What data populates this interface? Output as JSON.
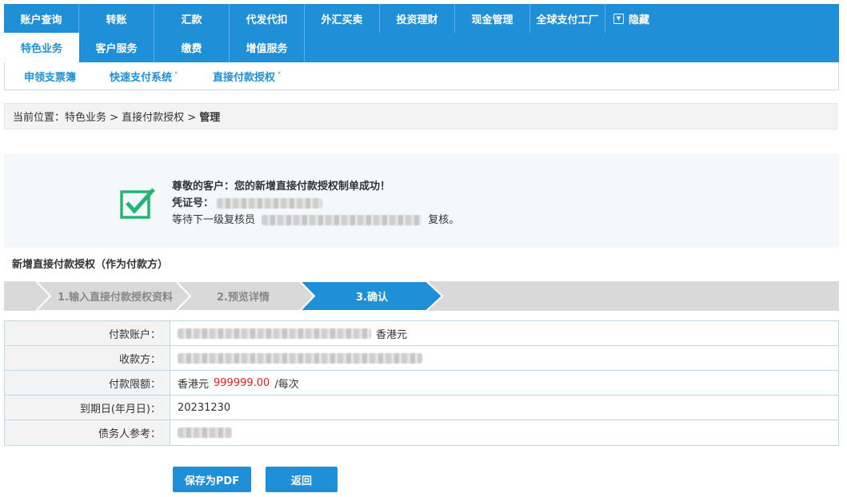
{
  "nav": {
    "row1": [
      "账户查询",
      "转账",
      "汇款",
      "代发代扣",
      "外汇买卖",
      "投资理财",
      "现金管理",
      "全球支付工厂"
    ],
    "hide_label": "隐藏",
    "row2": [
      "特色业务",
      "客户服务",
      "缴费",
      "增值服务"
    ]
  },
  "subnav": [
    "申领支票簿",
    "快速支付系统",
    "直接付款授权"
  ],
  "breadcrumb": {
    "prefix": "当前位置：特色业务 > 直接付款授权 >",
    "current": "管理"
  },
  "success": {
    "title": "尊敬的客户：您的新增直接付款授权制单成功！",
    "voucher_label": "凭证号：",
    "wait_prefix": "等待下一级复核员",
    "wait_suffix": "复核。"
  },
  "section_title": "新增直接付款授权（作为付款方）",
  "steps": [
    "1.输入直接付款授权资料",
    "2.预览详情",
    "3.确认"
  ],
  "form": {
    "payer_label": "付款账户：",
    "payer_currency": "香港元",
    "payee_label": "收款方：",
    "limit_label": "付款限额：",
    "limit_currency": "香港元",
    "limit_amount": "999999.00",
    "limit_unit": "/每次",
    "expiry_label": "到期日(年月日)：",
    "expiry_value": "20231230",
    "debtor_ref_label": "债务人参考："
  },
  "buttons": {
    "save_pdf": "保存为PDF",
    "back": "返回"
  },
  "colors": {
    "primary": "#1f8fd8",
    "success_green": "#21b573",
    "amount_red": "#e02020"
  }
}
